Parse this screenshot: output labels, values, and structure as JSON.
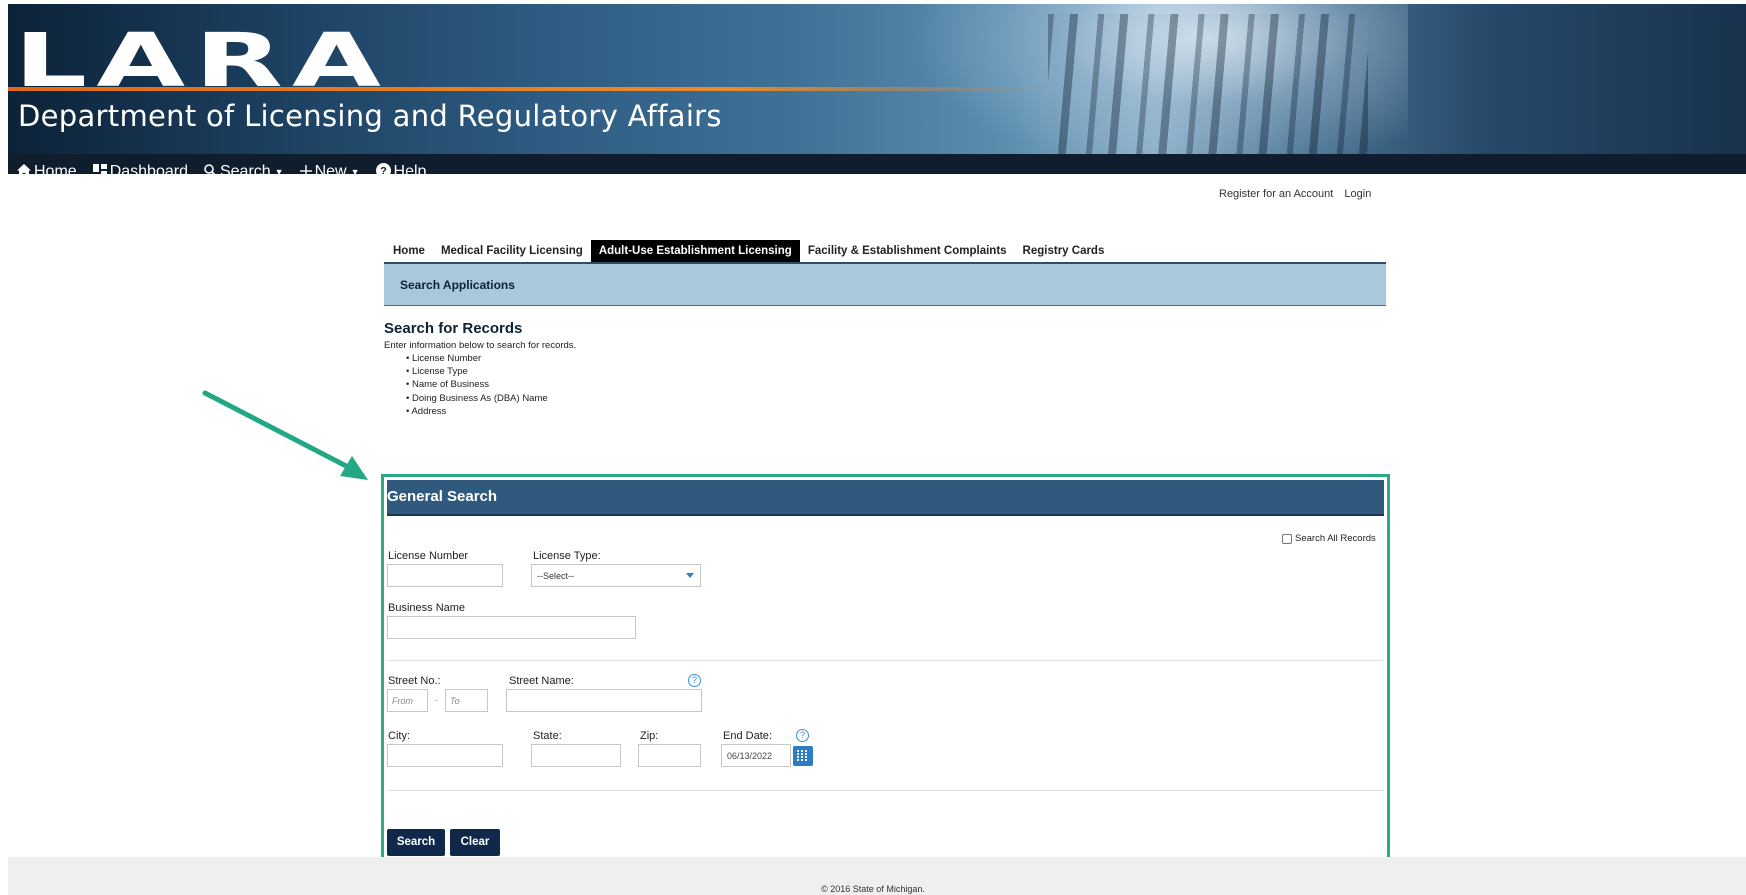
{
  "banner": {
    "logo": "LARA",
    "department": "Department of Licensing and Regulatory Affairs"
  },
  "nav": {
    "items": [
      {
        "label": "Home",
        "icon": "home-icon"
      },
      {
        "label": "Dashboard",
        "icon": "dashboard-icon"
      },
      {
        "label": "Search",
        "icon": "search-icon",
        "dropdown": true
      },
      {
        "label": "New",
        "icon": "plus-icon",
        "dropdown": true
      },
      {
        "label": "Help",
        "icon": "help-icon"
      }
    ]
  },
  "account": {
    "register": "Register for an Account",
    "login": "Login"
  },
  "tabs": [
    {
      "label": "Home",
      "active": false
    },
    {
      "label": "Medical Facility Licensing",
      "active": false
    },
    {
      "label": "Adult-Use Establishment Licensing",
      "active": true
    },
    {
      "label": "Facility & Establishment Complaints",
      "active": false
    },
    {
      "label": "Registry Cards",
      "active": false
    }
  ],
  "subnav": {
    "label": "Search Applications"
  },
  "records": {
    "title": "Search for Records",
    "description": "Enter information below to search for records.",
    "items": [
      "License Number",
      "License Type",
      "Name of Business",
      "Doing Business As (DBA) Name",
      "Address"
    ]
  },
  "search_panel": {
    "title": "General Search",
    "search_all_label": "Search All Records",
    "license_number_label": "License Number",
    "license_type_label": "License Type:",
    "license_type_value": "--Select--",
    "business_name_label": "Business Name",
    "street_no_label": "Street No.:",
    "street_from_placeholder": "From",
    "street_to_placeholder": "To",
    "street_name_label": "Street Name:",
    "city_label": "City:",
    "state_label": "State:",
    "zip_label": "Zip:",
    "end_date_label": "End Date:",
    "end_date_value": "06/13/2022",
    "help_glyph": "?",
    "search_button": "Search",
    "clear_button": "Clear"
  },
  "footer": {
    "copyright": "© 2016 State of Michigan."
  },
  "colors": {
    "nav_bg": "#0f1d2c",
    "subnav_bg": "#a9c8dc",
    "panel_header_bg": "#2f5a7e",
    "button_bg": "#10284a",
    "highlight_border": "#2aaa8a",
    "accent_orange": "#e26a16"
  }
}
